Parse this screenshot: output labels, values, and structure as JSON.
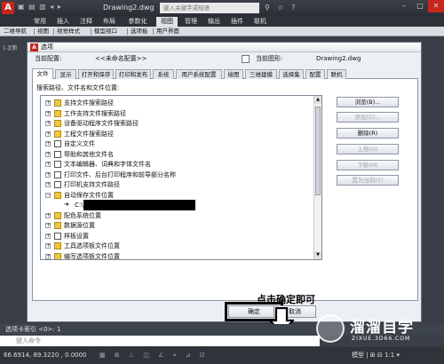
{
  "app": {
    "qa_icons": "▣ ▤ ▥ ◂ ▸",
    "window_title": "Drawing2.dwg",
    "search_placeholder": "键入关键字或短语",
    "win_controls": [
      "–",
      "□",
      "✕"
    ]
  },
  "ribbon_tabs": [
    "常用",
    "插入",
    "注释",
    "布局",
    "参数化",
    "视图",
    "管理",
    "输出",
    "插件",
    "联机"
  ],
  "ribbon_active_tab": "视图",
  "toolstrip": [
    "二维导航",
    "视图",
    "视觉样式",
    "模型视口",
    "选项板",
    "用户界面"
  ],
  "viewport_label": "[-][俯",
  "dialog": {
    "title": "选项",
    "current_profile_label": "当前配置:",
    "current_profile_value": "<<未命名配置>>",
    "current_drawing_label": "当前图形:",
    "current_drawing_value": "Drawing2.dwg",
    "tabs": [
      "文件",
      "显示",
      "打开和保存",
      "打印和发布",
      "系统",
      "用户系统配置",
      "绘图",
      "三维建模",
      "选择集",
      "配置",
      "联机"
    ],
    "tree_heading": "搜索路径、文件名和文件位置:",
    "tree_items": [
      {
        "label": "支持文件搜索路径",
        "icon": "folder",
        "exp": "+"
      },
      {
        "label": "工作支持文件搜索路径",
        "icon": "folder",
        "exp": "+"
      },
      {
        "label": "设备驱动程序文件搜索路径",
        "icon": "folder",
        "exp": "+"
      },
      {
        "label": "工程文件搜索路径",
        "icon": "folder",
        "exp": "+"
      },
      {
        "label": "自定义文件",
        "icon": "doc",
        "exp": "+"
      },
      {
        "label": "帮助和其他文件名",
        "icon": "doc",
        "exp": "+"
      },
      {
        "label": "文本编辑器、词典和字体文件名",
        "icon": "doc",
        "exp": "+"
      },
      {
        "label": "打印文件、后台打印程序和前导部分名称",
        "icon": "doc",
        "exp": "+"
      },
      {
        "label": "打印机支持文件路径",
        "icon": "doc",
        "exp": "+"
      },
      {
        "label": "自动保存文件位置",
        "icon": "folder",
        "exp": "−"
      },
      {
        "label": "配色系统位置",
        "icon": "folder",
        "exp": "+"
      },
      {
        "label": "数据源位置",
        "icon": "folder",
        "exp": "+"
      },
      {
        "label": "样板设置",
        "icon": "doc",
        "exp": "+"
      },
      {
        "label": "工具选项板文件位置",
        "icon": "folder",
        "exp": "+"
      },
      {
        "label": "编写选项板文件位置",
        "icon": "folder",
        "exp": "+"
      }
    ],
    "autosave_path": "C:\\",
    "side_buttons": [
      {
        "label": "浏览(B)...",
        "enabled": true
      },
      {
        "label": "添加(D)...",
        "enabled": false
      },
      {
        "label": "删除(R)",
        "enabled": true
      },
      {
        "label": "上移(U)",
        "enabled": false
      },
      {
        "label": "下移(M)",
        "enabled": false
      },
      {
        "label": "置为当前(S)",
        "enabled": false
      }
    ],
    "ok_label": "确定",
    "cancel_label": "取消"
  },
  "annotation": "点击确定即可",
  "command": {
    "history": "选项卡索引 <0>: 1",
    "input_placeholder": "键入命令"
  },
  "status": {
    "coords": "66.6914, 89.3220 , 0.0000",
    "icons": "▦ ⊞ ⊥ ◫ ∠ ⌖ ⊿ ⊡",
    "model": "模型 | ⊞ ⊟ 1:1 ▾"
  },
  "watermark": {
    "name": "溜溜自学",
    "url": "ZIXUE.3D66.COM"
  },
  "colors": {
    "accent_red": "#c8261d",
    "ribbon_active": "#dfe3e8",
    "folder_yellow": "#e9c94a"
  }
}
